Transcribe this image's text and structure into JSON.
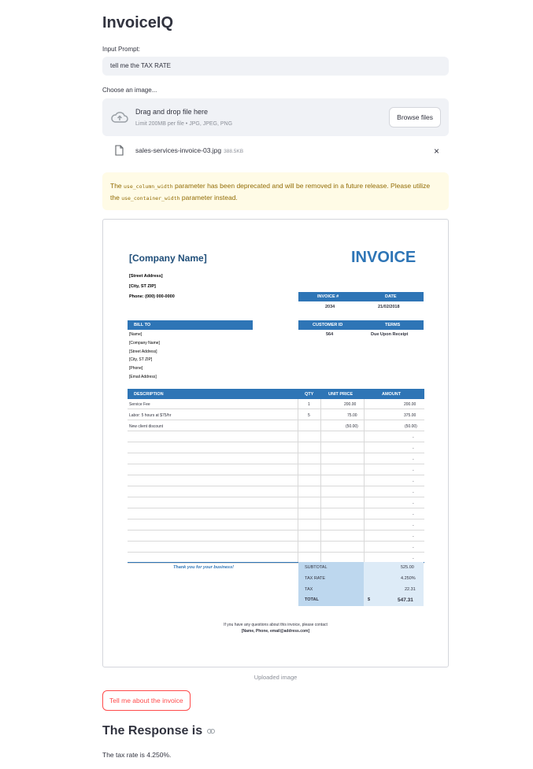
{
  "app": {
    "title": "InvoiceIQ"
  },
  "prompt": {
    "label": "Input Prompt:",
    "value": "tell me the TAX RATE"
  },
  "uploader": {
    "label": "Choose an image...",
    "drop_text": "Drag and drop file here",
    "limit_text": "Limit 200MB per file • JPG, JPEG, PNG",
    "browse_label": "Browse files",
    "icon": "cloud-upload-icon"
  },
  "file": {
    "name": "sales-services-invoice-03.jpg",
    "size": "388.5KB",
    "close": "×"
  },
  "warning": {
    "p1": "The ",
    "code1": "use_column_width",
    "p2": " parameter has been deprecated and will be removed in a future release. Please utilize the ",
    "code2": "use_container_width",
    "p3": " parameter instead."
  },
  "invoice": {
    "company": "[Company Name]",
    "title": "INVOICE",
    "street": "[Street Address]",
    "city": "[City, ST ZIP]",
    "phone": "Phone: (000) 000-0000",
    "invoice_no_label": "INVOICE #",
    "invoice_no": "2034",
    "date_label": "DATE",
    "date": "21/02/2018",
    "bill_to_label": "BILL TO",
    "customer_id_label": "CUSTOMER ID",
    "customer_id": "564",
    "terms_label": "TERMS",
    "terms": "Due Upon Receipt",
    "bill_lines": [
      "[Name]",
      "[Company Name]",
      "[Street Address]",
      "[City, ST ZIP]",
      "[Phone]",
      "[Email Address]"
    ],
    "col_description": "DESCRIPTION",
    "col_qty": "QTY",
    "col_unit_price": "UNIT PRICE",
    "col_amount": "AMOUNT",
    "items": [
      {
        "desc": "Service Fee",
        "qty": "1",
        "price": "200.00",
        "amount": "200.00"
      },
      {
        "desc": "Labor: 5 hours at $75/hr",
        "qty": "5",
        "price": "75.00",
        "amount": "375.00"
      },
      {
        "desc": "New client discount",
        "qty": "",
        "price": "(50.00)",
        "amount": "(50.00)"
      }
    ],
    "empty_amount": "-",
    "thanks": "Thank you for your business!",
    "subtotal_label": "SUBTOTAL",
    "subtotal": "525.00",
    "tax_rate_label": "TAX RATE",
    "tax_rate": "4.250%",
    "tax_label": "TAX",
    "tax": "22.31",
    "total_label": "TOTAL",
    "currency": "$",
    "total": "547.31",
    "footer1": "If you have any questions about this invoice, please contact",
    "footer2": "[Name, Phone, email@address.com]"
  },
  "image_caption": "Uploaded image",
  "action_button": "Tell me about the invoice",
  "response": {
    "heading": "The Response is",
    "text": "The tax rate is 4.250%."
  },
  "colors": {
    "accent": "#ff4b4b",
    "invoice_blue": "#2e75b6",
    "warning_bg": "#fffbe6"
  }
}
